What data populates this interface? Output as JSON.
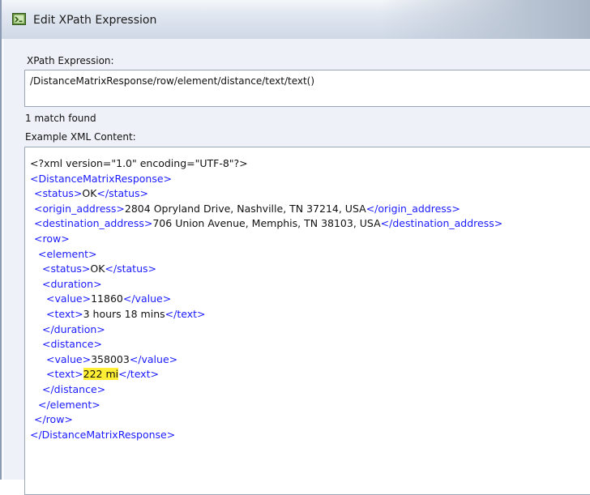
{
  "window": {
    "title": "Edit XPath Expression",
    "icon": "xpath-app-icon"
  },
  "xpath": {
    "label": "XPath Expression:",
    "value": "/DistanceMatrixResponse/row/element/distance/text/text()"
  },
  "status": {
    "match_text": "1 match found"
  },
  "xml": {
    "label": "Example XML Content:",
    "lines": [
      {
        "indent": 0,
        "parts": [
          {
            "k": "txt",
            "t": "<?xml version=\"1.0\" encoding=\"UTF-8\"?>"
          }
        ]
      },
      {
        "indent": 0,
        "parts": [
          {
            "k": "tag",
            "t": "<DistanceMatrixResponse>"
          }
        ]
      },
      {
        "indent": 1,
        "parts": [
          {
            "k": "tag",
            "t": "<status>"
          },
          {
            "k": "txt",
            "t": "OK"
          },
          {
            "k": "tag",
            "t": "</status>"
          }
        ]
      },
      {
        "indent": 1,
        "parts": [
          {
            "k": "tag",
            "t": "<origin_address>"
          },
          {
            "k": "txt",
            "t": "2804 Opryland Drive, Nashville, TN 37214, USA"
          },
          {
            "k": "tag",
            "t": "</origin_address>"
          }
        ]
      },
      {
        "indent": 1,
        "parts": [
          {
            "k": "tag",
            "t": "<destination_address>"
          },
          {
            "k": "txt",
            "t": "706 Union Avenue, Memphis, TN 38103, USA"
          },
          {
            "k": "tag",
            "t": "</destination_address>"
          }
        ]
      },
      {
        "indent": 1,
        "parts": [
          {
            "k": "tag",
            "t": "<row>"
          }
        ]
      },
      {
        "indent": 2,
        "parts": [
          {
            "k": "tag",
            "t": "<element>"
          }
        ]
      },
      {
        "indent": 3,
        "parts": [
          {
            "k": "tag",
            "t": "<status>"
          },
          {
            "k": "txt",
            "t": "OK"
          },
          {
            "k": "tag",
            "t": "</status>"
          }
        ]
      },
      {
        "indent": 3,
        "parts": [
          {
            "k": "tag",
            "t": "<duration>"
          }
        ]
      },
      {
        "indent": 4,
        "parts": [
          {
            "k": "tag",
            "t": "<value>"
          },
          {
            "k": "txt",
            "t": "11860"
          },
          {
            "k": "tag",
            "t": "</value>"
          }
        ]
      },
      {
        "indent": 4,
        "parts": [
          {
            "k": "tag",
            "t": "<text>"
          },
          {
            "k": "txt",
            "t": "3 hours 18 mins"
          },
          {
            "k": "tag",
            "t": "</text>"
          }
        ]
      },
      {
        "indent": 3,
        "parts": [
          {
            "k": "tag",
            "t": "</duration>"
          }
        ]
      },
      {
        "indent": 3,
        "parts": [
          {
            "k": "tag",
            "t": "<distance>"
          }
        ]
      },
      {
        "indent": 4,
        "parts": [
          {
            "k": "tag",
            "t": "<value>"
          },
          {
            "k": "txt",
            "t": "358003"
          },
          {
            "k": "tag",
            "t": "</value>"
          }
        ]
      },
      {
        "indent": 4,
        "parts": [
          {
            "k": "tag",
            "t": "<text>"
          },
          {
            "k": "hl",
            "t": "222 mi"
          },
          {
            "k": "tag",
            "t": "</text>"
          }
        ]
      },
      {
        "indent": 3,
        "parts": [
          {
            "k": "tag",
            "t": "</distance>"
          }
        ]
      },
      {
        "indent": 2,
        "parts": [
          {
            "k": "tag",
            "t": "</element>"
          }
        ]
      },
      {
        "indent": 1,
        "parts": [
          {
            "k": "tag",
            "t": "</row>"
          }
        ]
      },
      {
        "indent": 0,
        "parts": [
          {
            "k": "tag",
            "t": "</DistanceMatrixResponse>"
          }
        ]
      }
    ]
  },
  "colors": {
    "tag": "#1a1aff",
    "highlight": "#ffee33",
    "text": "#111111"
  }
}
